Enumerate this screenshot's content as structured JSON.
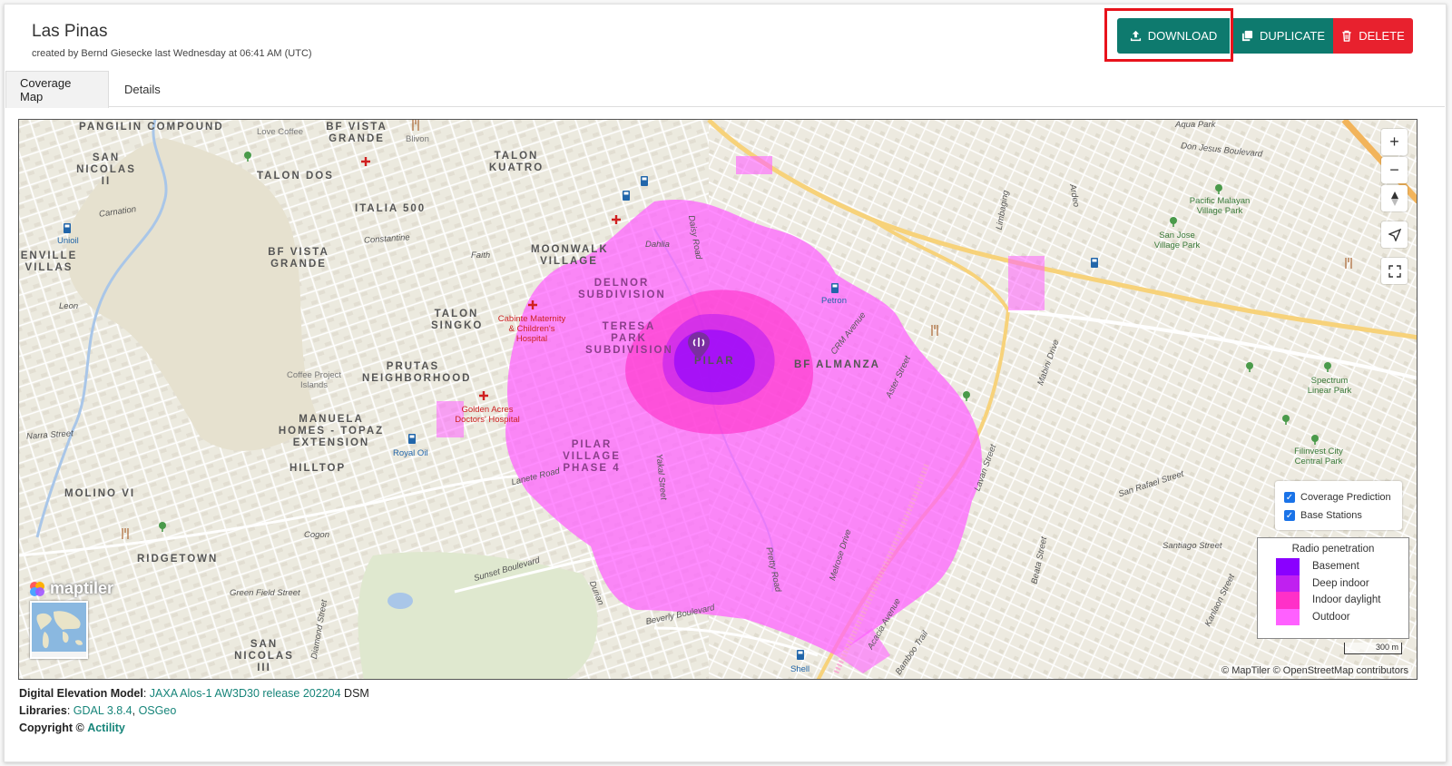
{
  "header": {
    "title": "Las Pinas",
    "subtitle": "created by Bernd Giesecke last Wednesday at 06:41 AM (UTC)"
  },
  "actions": {
    "download": "DOWNLOAD",
    "duplicate": "DUPLICATE",
    "delete": "DELETE"
  },
  "tabs": [
    {
      "label": "Coverage Map",
      "active": true
    },
    {
      "label": "Details",
      "active": false
    }
  ],
  "map": {
    "places": [
      "PANGILIN COMPOUND",
      "SAN NICOLAS II",
      "TALON DOS",
      "BF VISTA GRANDE",
      "TALON KUATRO",
      "ITALIA 500",
      "BF VISTA GRANDE",
      "MOONWALK VILLAGE",
      "DELNOR SUBDIVISION",
      "TERESA PARK SUBDIVISION",
      "PILAR",
      "BF ALMANZA",
      "TALON SINGKO",
      "PRUTAS NEIGHBORHOOD",
      "MANUELA HOMES - TOPAZ EXTENSION",
      "HILLTOP",
      "PILAR VILLAGE PHASE 4",
      "MOLINO VI",
      "RIDGETOWN",
      "SAN NICOLAS III",
      "ENVILLE VILLAS"
    ],
    "roads": [
      "Carnation",
      "Constantine",
      "Faith",
      "Leon",
      "Narra Street",
      "Cogon",
      "Lanete Road",
      "Sunset Boulevard",
      "Green Field Street",
      "Diamond Street",
      "Beverly Boulevard",
      "Don Jesus Boulevard",
      "Limbaging",
      "Ardeo",
      "Mabini Drive",
      "Lavan Street",
      "San Rafael Street",
      "Santiago Street",
      "Beata Street",
      "Kanlaon Street",
      "Acacia Avenue",
      "Bamboo Trail",
      "Melrose Drive",
      "Pretty Road",
      "Yakal Street",
      "Durian",
      "Daisy Road",
      "Dahlia",
      "Aster Street",
      "CRM Avenue",
      "Aqua Park"
    ],
    "pois": [
      "Love Coffee",
      "Blivon",
      "Unioil",
      "Cabinte Maternity & Children's Hospital",
      "Petron",
      "Coffee Project Islands",
      "Golden Acres Doctors' Hospital",
      "Royal Oil",
      "Pacific Malayan Village Park",
      "San Jose Village Park",
      "Spectrum Linear Park",
      "Filinvest City Central Park",
      "Shell"
    ],
    "icons": [
      "marker-icon",
      "hospital-icon",
      "fuel-icon",
      "restaurant-icon",
      "park-icon"
    ]
  },
  "layers": {
    "coverage": "Coverage Prediction",
    "stations": "Base Stations"
  },
  "legend": {
    "title": "Radio penetration",
    "items": [
      {
        "label": "Basement",
        "color": "#8a00ff"
      },
      {
        "label": "Deep indoor",
        "color": "#c020f0"
      },
      {
        "label": "Indoor daylight",
        "color": "#ff30c8"
      },
      {
        "label": "Outdoor",
        "color": "#ff60ff"
      }
    ]
  },
  "scale": "300 m",
  "attribution": "© MapTiler © OpenStreetMap contributors",
  "maptiler_logo": "maptiler",
  "footer": {
    "dem_label": "Digital Elevation Model",
    "dem_link": "JAXA Alos-1 AW3D30 release 202204",
    "dem_suffix": "DSM",
    "lib_label": "Libraries",
    "lib_gdal": "GDAL 3.8.4",
    "lib_osgeo": "OSGeo",
    "copy_label": "Copyright ©",
    "copy_link": "Actility"
  }
}
